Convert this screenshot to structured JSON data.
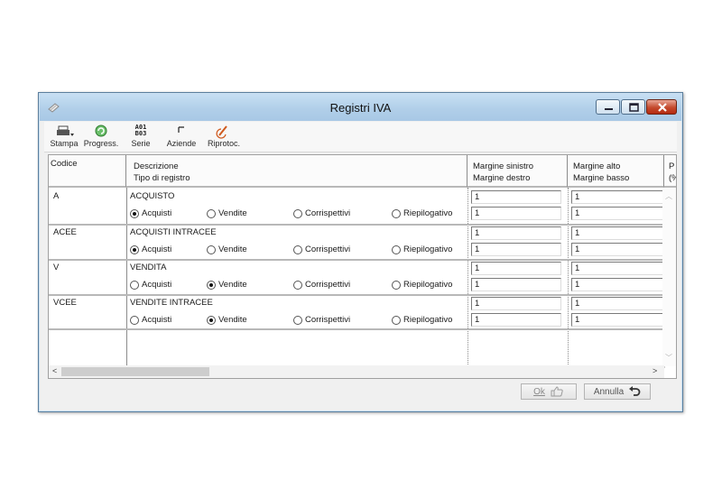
{
  "window": {
    "title": "Registri IVA"
  },
  "toolbar": {
    "stampa": "Stampa",
    "progress": "Progress.",
    "serie": "Serie",
    "serie_icon_line1": "A01",
    "serie_icon_line2": "B03",
    "aziende": "Aziende",
    "riprotoc": "Riprotoc."
  },
  "grid": {
    "headers": {
      "codice": "Codice",
      "descrizione": "Descrizione",
      "tipo": "Tipo di registro",
      "margine_sinistro": "Margine sinistro",
      "margine_destro": "Margine destro",
      "margine_alto": "Margine alto",
      "margine_basso": "Margine basso",
      "next_line1": "P",
      "next_line2": "(%"
    },
    "radio_labels": [
      "Acquisti",
      "Vendite",
      "Corrispettivi",
      "Riepilogativo"
    ],
    "rows": [
      {
        "codice": "A",
        "descrizione": "ACQUISTO",
        "selected": 0,
        "sinistro": "1",
        "destro": "1",
        "alto": "1",
        "basso": "1"
      },
      {
        "codice": "ACEE",
        "descrizione": "ACQUISTI INTRACEE",
        "selected": 0,
        "sinistro": "1",
        "destro": "1",
        "alto": "1",
        "basso": "1"
      },
      {
        "codice": "V",
        "descrizione": "VENDITA",
        "selected": 1,
        "sinistro": "1",
        "destro": "1",
        "alto": "1",
        "basso": "1"
      },
      {
        "codice": "VCEE",
        "descrizione": "VENDITE INTRACEE",
        "selected": 1,
        "sinistro": "1",
        "destro": "1",
        "alto": "1",
        "basso": "1"
      }
    ]
  },
  "buttons": {
    "ok": "Ok",
    "annulla": "Annulla"
  }
}
